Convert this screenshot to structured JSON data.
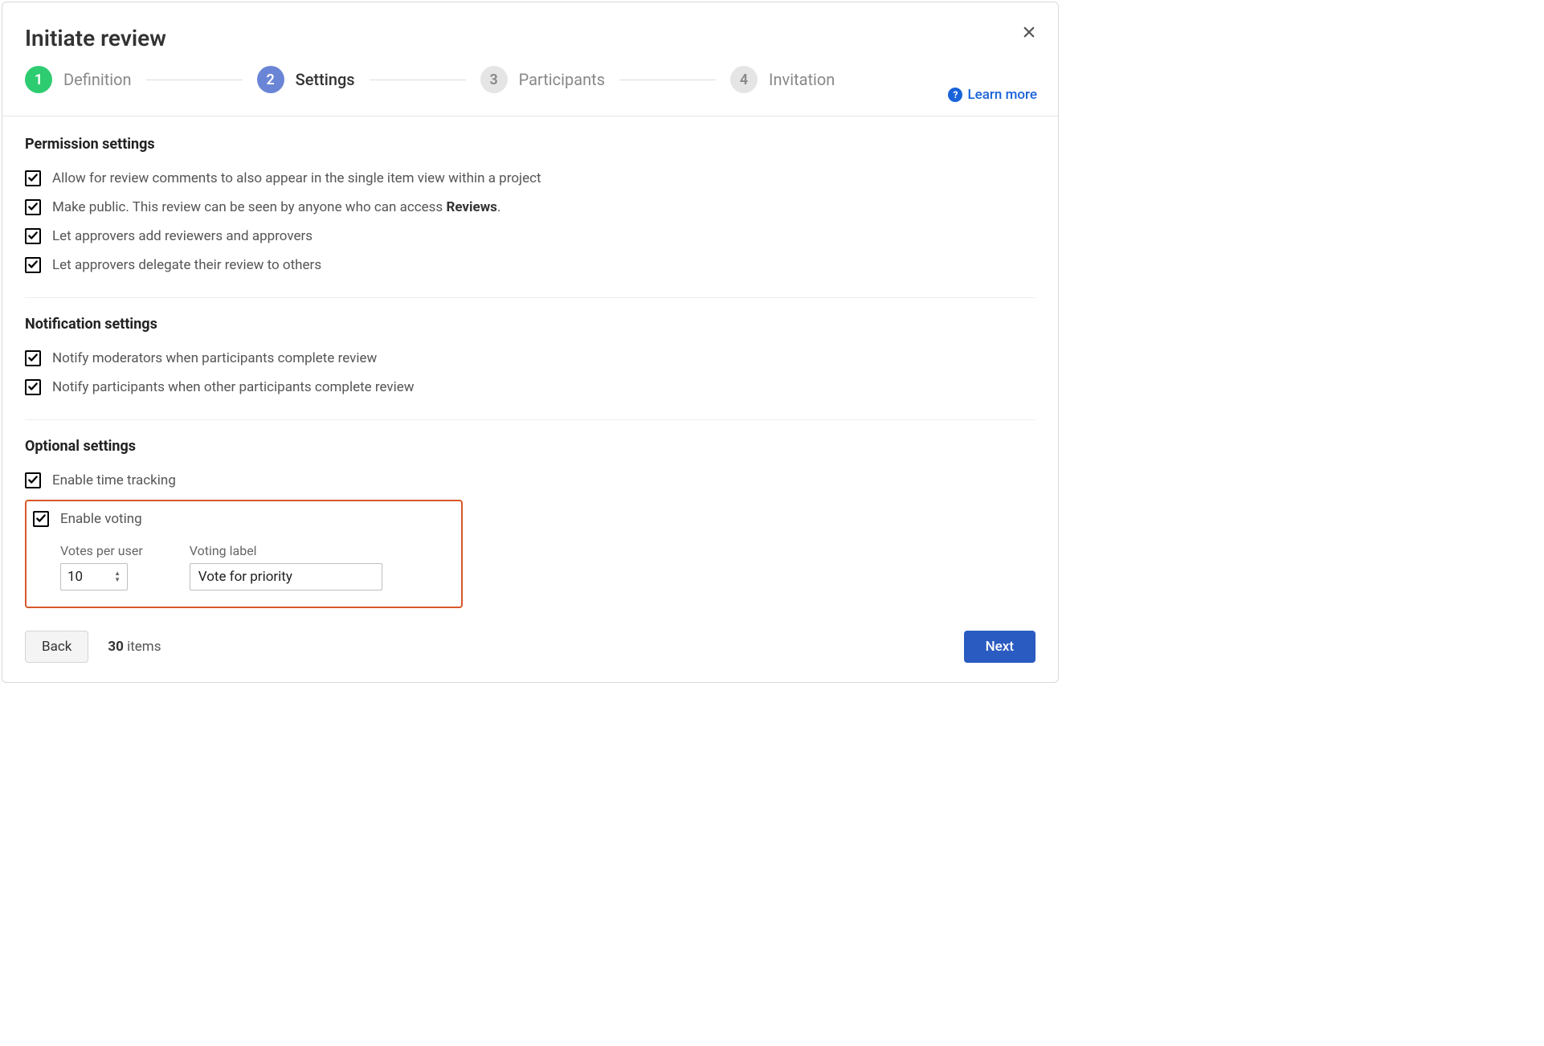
{
  "header": {
    "title": "Initiate review",
    "learn_more": "Learn more"
  },
  "steps": [
    {
      "num": "1",
      "label": "Definition"
    },
    {
      "num": "2",
      "label": "Settings"
    },
    {
      "num": "3",
      "label": "Participants"
    },
    {
      "num": "4",
      "label": "Invitation"
    }
  ],
  "sections": {
    "permission": {
      "title": "Permission settings",
      "allow_comments": "Allow for review comments to also appear in the single item view within a project",
      "make_public_prefix": "Make public. This review can be seen by anyone who can access ",
      "make_public_strong": "Reviews",
      "make_public_suffix": ".",
      "add_reviewers": "Let approvers add reviewers and approvers",
      "delegate": "Let approvers delegate their review to others"
    },
    "notification": {
      "title": "Notification settings",
      "notify_moderators": "Notify moderators when participants complete review",
      "notify_participants": "Notify participants when other participants complete review"
    },
    "optional": {
      "title": "Optional settings",
      "time_tracking": "Enable time tracking",
      "voting": "Enable voting",
      "votes_per_user_label": "Votes per user",
      "votes_per_user_value": "10",
      "voting_label_label": "Voting label",
      "voting_label_value": "Vote for priority"
    }
  },
  "footer": {
    "back": "Back",
    "next": "Next",
    "items_count": "30",
    "items_word": " items"
  }
}
